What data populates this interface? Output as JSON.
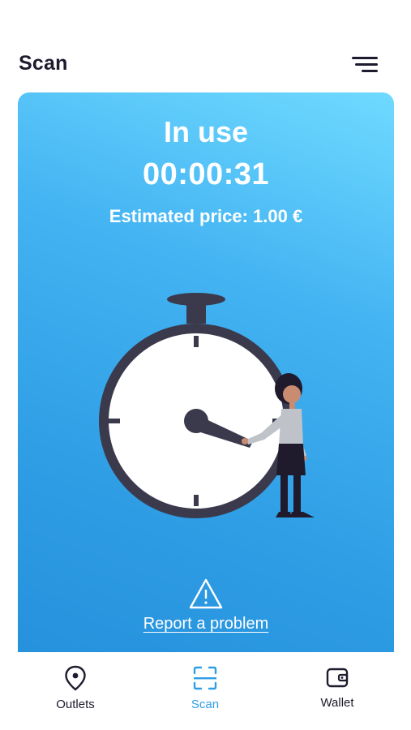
{
  "header": {
    "title": "Scan",
    "menu_icon": "hamburger-menu-icon"
  },
  "session": {
    "status": "In use",
    "elapsed": "00:00:31",
    "price_label": "Estimated price: 1.00 €"
  },
  "illustration": {
    "subject": "stopwatch-with-person-icon"
  },
  "report": {
    "icon": "warning-triangle-icon",
    "label": "Report a problem"
  },
  "bottom_nav": {
    "items": [
      {
        "label": "Outlets",
        "icon": "location-pin-icon",
        "active": false
      },
      {
        "label": "Scan",
        "icon": "scan-frame-icon",
        "active": true
      },
      {
        "label": "Wallet",
        "icon": "wallet-icon",
        "active": false
      }
    ]
  },
  "colors": {
    "card_gradient_top": "#6fdaff",
    "card_gradient_bottom": "#2691dd",
    "active_nav": "#2f9ee5",
    "text_dark": "#1c1c2e",
    "stopwatch_dark": "#3b3a4d"
  }
}
